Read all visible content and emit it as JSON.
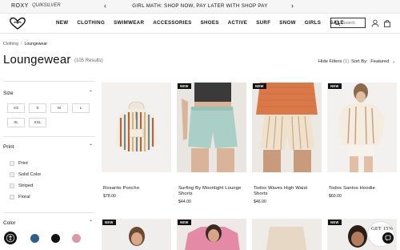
{
  "topbar": {
    "brand": "ROXY",
    "sister_brand": "QUIKSILVER",
    "promo": "GIRL MATH: SHOP NOW, PAY LATER WITH SHOP PAY",
    "prev_icon": "chevron-left-icon",
    "next_icon": "chevron-right-icon"
  },
  "header": {
    "logo": "roxy-heart-logo",
    "nav": [
      "NEW",
      "CLOTHING",
      "SWIMWEAR",
      "ACCESSORIES",
      "SHOES",
      "ACTIVE",
      "SURF",
      "SNOW",
      "GIRLS",
      "SALE"
    ],
    "search_placeholder": "Search",
    "account_icon": "user-icon",
    "cart_icon": "bag-icon"
  },
  "breadcrumb": {
    "parent": "Clothing",
    "separator": "/",
    "current": "Loungewear"
  },
  "title": "Loungewear",
  "result_count": "(105 Results)",
  "toolbar": {
    "hide_filters": "Hide Filters",
    "filter_count": "(1)",
    "sort_label": "Sort By:",
    "sort_value": "Featured"
  },
  "filters": {
    "size": {
      "title": "Size",
      "options": [
        "XS",
        "S",
        "M",
        "L",
        "XL",
        "XXL"
      ]
    },
    "print": {
      "title": "Print",
      "options": [
        "Print",
        "Solid Color",
        "Striped",
        "Floral"
      ]
    },
    "color": {
      "title": "Color",
      "swatches": [
        "#2d5f8a",
        "#111111",
        "#d99aa8"
      ]
    }
  },
  "products": [
    {
      "name": "Rosarito Poncho",
      "price": "$78.00",
      "is_new": false
    },
    {
      "name": "Surfing By Moonlight Lounge Shorts",
      "price": "$44.00",
      "is_new": true
    },
    {
      "name": "Todos Waves High Waist Shorts",
      "price": "$46.00",
      "is_new": true
    },
    {
      "name": "Todos Santos Hoodie",
      "price": "$60.00",
      "is_new": true
    }
  ],
  "badges": {
    "new": "NEW"
  },
  "promo_float": "GET 15%",
  "colors": {
    "accent": "#111111",
    "border": "#e3e3e3",
    "swatch_blue": "#2d5f8a",
    "swatch_black": "#111111",
    "swatch_pink": "#d99aa8"
  }
}
